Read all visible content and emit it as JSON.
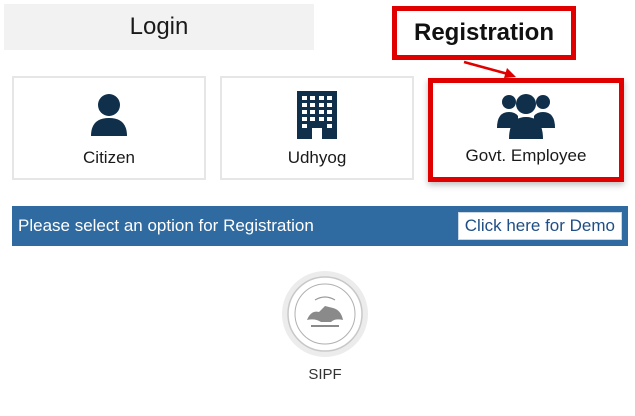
{
  "tabs": {
    "login_label": "Login",
    "registration_label": "Registration"
  },
  "cards": [
    {
      "label": "Citizen",
      "icon": "user-icon"
    },
    {
      "label": "Udhyog",
      "icon": "building-icon"
    },
    {
      "label": "Govt. Employee",
      "icon": "users-group-icon"
    }
  ],
  "info_bar": {
    "message": "Please select an option for Registration",
    "demo_button_label": "Click here for Demo"
  },
  "logo": {
    "caption": "SIPF"
  },
  "colors": {
    "highlight_red": "#e00000",
    "bar_blue": "#2f6aa0",
    "icon_navy": "#0f2f4a"
  }
}
